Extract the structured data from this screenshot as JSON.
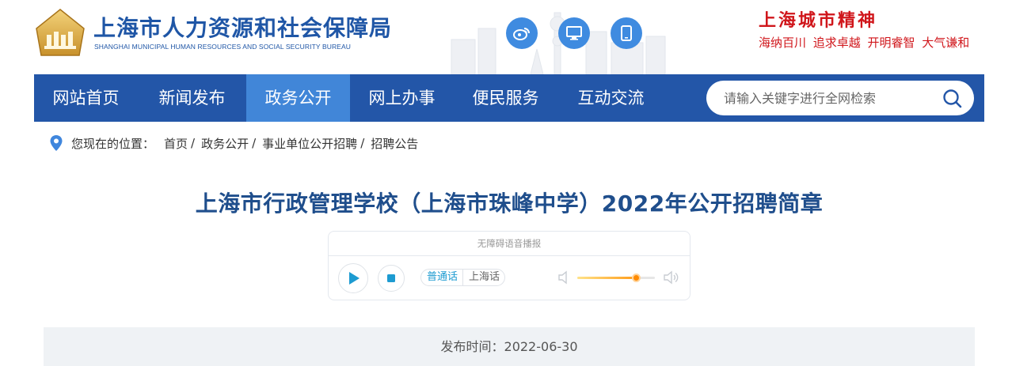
{
  "header": {
    "org_name_cn": "上海市人力资源和社会保障局",
    "org_name_en": "SHANGHAI MUNICIPAL HUMAN RESOURCES AND SOCIAL SECURITY BUREAU",
    "icons": [
      "weibo-icon",
      "desktop-icon",
      "mobile-icon"
    ],
    "slogan_title": "上海城市精神",
    "slogan": "海纳百川 追求卓越 开明睿智 大气谦和",
    "colors": {
      "brand_blue": "#1f56a6",
      "slogan_red": "#d0161b",
      "icon_blue": "#3f8be0"
    }
  },
  "nav": {
    "items": [
      {
        "label": "网站首页"
      },
      {
        "label": "新闻发布"
      },
      {
        "label": "政务公开"
      },
      {
        "label": "网上办事"
      },
      {
        "label": "便民服务"
      },
      {
        "label": "互动交流"
      }
    ],
    "active": "政务公开",
    "search": {
      "placeholder": "请输入关键字进行全网检索",
      "value": ""
    },
    "colors": {
      "bar": "#2356a8",
      "active": "#4186d8"
    }
  },
  "breadcrumb": {
    "label": "您现在的位置：",
    "items": [
      "首页",
      "政务公开",
      "事业单位公开招聘",
      "招聘公告"
    ],
    "separator": "/"
  },
  "article": {
    "title": "上海市行政管理学校（上海市珠峰中学）2022年公开招聘简章",
    "publish_label": "发布时间：",
    "publish_date": "2022-06-30"
  },
  "player": {
    "caption": "无障碍语音播报",
    "languages": [
      {
        "label": "普通话",
        "selected": true
      },
      {
        "label": "上海话",
        "selected": false
      }
    ],
    "volume_fraction": 0.76,
    "accent_color": "#1d9bd1"
  }
}
